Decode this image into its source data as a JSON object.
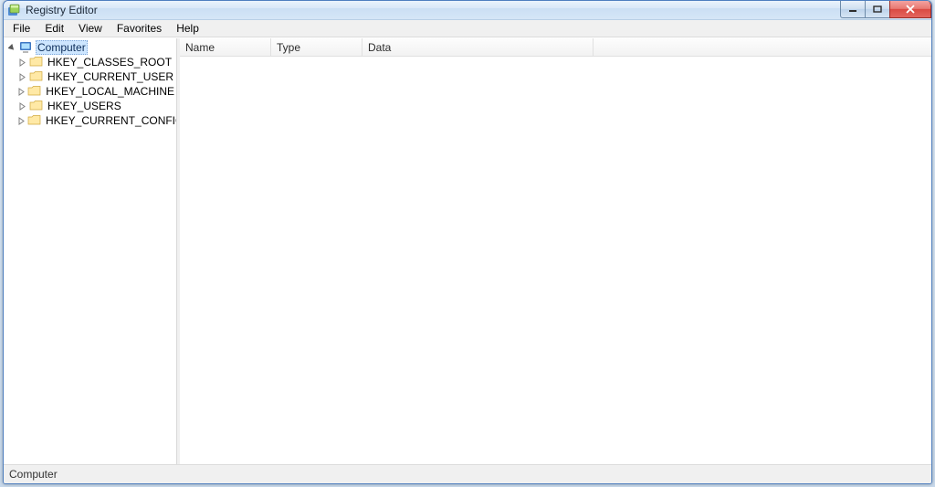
{
  "window": {
    "title": "Registry Editor"
  },
  "menu": {
    "file": "File",
    "edit": "Edit",
    "view": "View",
    "favorites": "Favorites",
    "help": "Help"
  },
  "tree": {
    "root": "Computer",
    "items": [
      {
        "label": "HKEY_CLASSES_ROOT"
      },
      {
        "label": "HKEY_CURRENT_USER"
      },
      {
        "label": "HKEY_LOCAL_MACHINE"
      },
      {
        "label": "HKEY_USERS"
      },
      {
        "label": "HKEY_CURRENT_CONFIG"
      }
    ]
  },
  "columns": {
    "name": "Name",
    "type": "Type",
    "data": "Data"
  },
  "status": {
    "path": "Computer"
  }
}
